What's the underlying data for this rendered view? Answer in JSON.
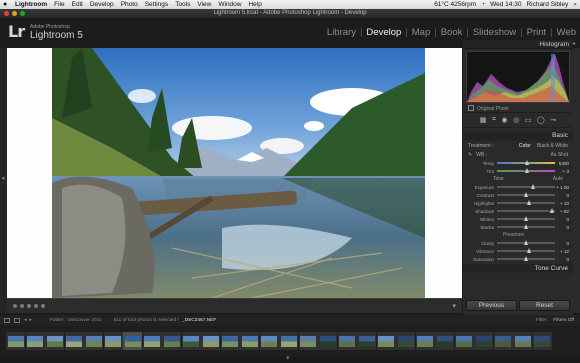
{
  "menubar": {
    "apple": "",
    "items": [
      "Lightroom",
      "File",
      "Edit",
      "Develop",
      "Photo",
      "Settings",
      "Tools",
      "View",
      "Window",
      "Help"
    ],
    "status": [
      "61°C 4256rpm",
      "Wed 14:30",
      "Richard Sibley"
    ]
  },
  "window": {
    "title": "Lightroom 5.lrcat - Adobe Photoshop Lightroom - Develop"
  },
  "identity": {
    "logo": "Lr",
    "small": "Adobe Photoshop",
    "product": "Lightroom 5"
  },
  "modules": [
    "Library",
    "Develop",
    "Map",
    "Book",
    "Slideshow",
    "Print",
    "Web"
  ],
  "active_module": "Develop",
  "panel": {
    "histogram": "Histogram",
    "original_photo": "Original Photo",
    "basic": "Basic",
    "treatment": "Treatment :",
    "color": "Color",
    "bw": "Black & White",
    "wb": "WB :",
    "wb_value": "As Shot",
    "temp": {
      "label": "Temp",
      "value": "5300",
      "pos": 0.52
    },
    "tint": {
      "label": "Tint",
      "value": "+ 3",
      "pos": 0.52
    },
    "tone": "Tone",
    "auto": "Auto",
    "sliders": [
      {
        "label": "Exposure",
        "value": "+ 1.00",
        "pos": 0.62
      },
      {
        "label": "Contrast",
        "value": "0",
        "pos": 0.5
      },
      {
        "label": "Highlights",
        "value": "+ 10",
        "pos": 0.55
      },
      {
        "label": "Shadows",
        "value": "+ 92",
        "pos": 0.94
      },
      {
        "label": "Whites",
        "value": "0",
        "pos": 0.5
      },
      {
        "label": "Blacks",
        "value": "0",
        "pos": 0.5
      }
    ],
    "presence": "Presence",
    "presence_sliders": [
      {
        "label": "Clarity",
        "value": "0",
        "pos": 0.5
      },
      {
        "label": "Vibrance",
        "value": "+ 12",
        "pos": 0.56
      },
      {
        "label": "Saturation",
        "value": "0",
        "pos": 0.5
      }
    ],
    "tone_curve": "Tone Curve",
    "previous": "Previous",
    "reset": "Reset"
  },
  "filmstrip": {
    "folder": "Folder : Vancouver 2011",
    "count": "611 of 643 photos /1 selected /",
    "filename": "_DSC2467.NEF",
    "filter": "Filter :",
    "filter_value": "Filters Off"
  },
  "colors": {
    "accent": "#f0f0f0",
    "panel": "#2a2a2a",
    "background": "#1b1b1b"
  }
}
